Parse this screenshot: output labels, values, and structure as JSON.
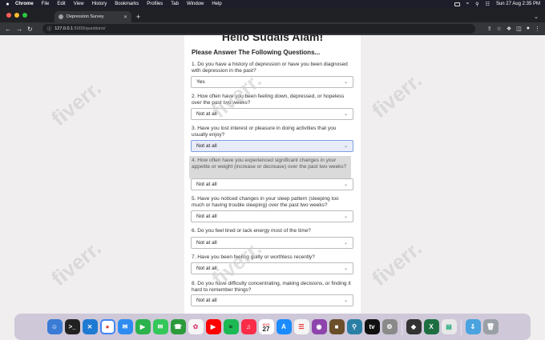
{
  "menubar": {
    "app": "Chrome",
    "items": [
      "File",
      "Edit",
      "View",
      "History",
      "Bookmarks",
      "Profiles",
      "Tab",
      "Window",
      "Help"
    ],
    "datetime": "Sun 27 Aug  2:35 PM"
  },
  "browser": {
    "tab_title": "Depression Survey",
    "url_host": "127.0.0.1",
    "url_path": ":5000/questions/"
  },
  "page": {
    "title": "Hello Sudais Alam!",
    "subtitle": "Please Answer The Following Questions...",
    "questions": [
      {
        "text": "1. Do you have a history of depression or have you been diagnosed with depression in the past?",
        "answer": "Yes"
      },
      {
        "text": "2. How often have you been feeling down, depressed, or hopeless over the past two weeks?",
        "answer": "Not at all"
      },
      {
        "text": "3. Have you lost interest or pleasure in doing activities that you usually enjoy?",
        "answer": "Not at all"
      },
      {
        "text": "4. How often have you experienced significant changes in your appetite or weight (increase or decrease) over the past two weeks?",
        "answer": "Not at all"
      },
      {
        "text": "5. Have you noticed changes in your sleep pattern (sleeping too much or having trouble sleeping) over the past two weeks?",
        "answer": "Not at all"
      },
      {
        "text": "6. Do you feel tired or lack energy most of the time?",
        "answer": "Not at all"
      },
      {
        "text": "7. Have you been feeling guilty or worthless recently?",
        "answer": "Not at all"
      },
      {
        "text": "8. Do you have difficulty concentrating, making decisions, or finding it hard to remember things?",
        "answer": "Not at all"
      }
    ]
  },
  "watermark": "fiverr.",
  "dock": {
    "calendar_month": "AUG",
    "calendar_day": "27"
  }
}
